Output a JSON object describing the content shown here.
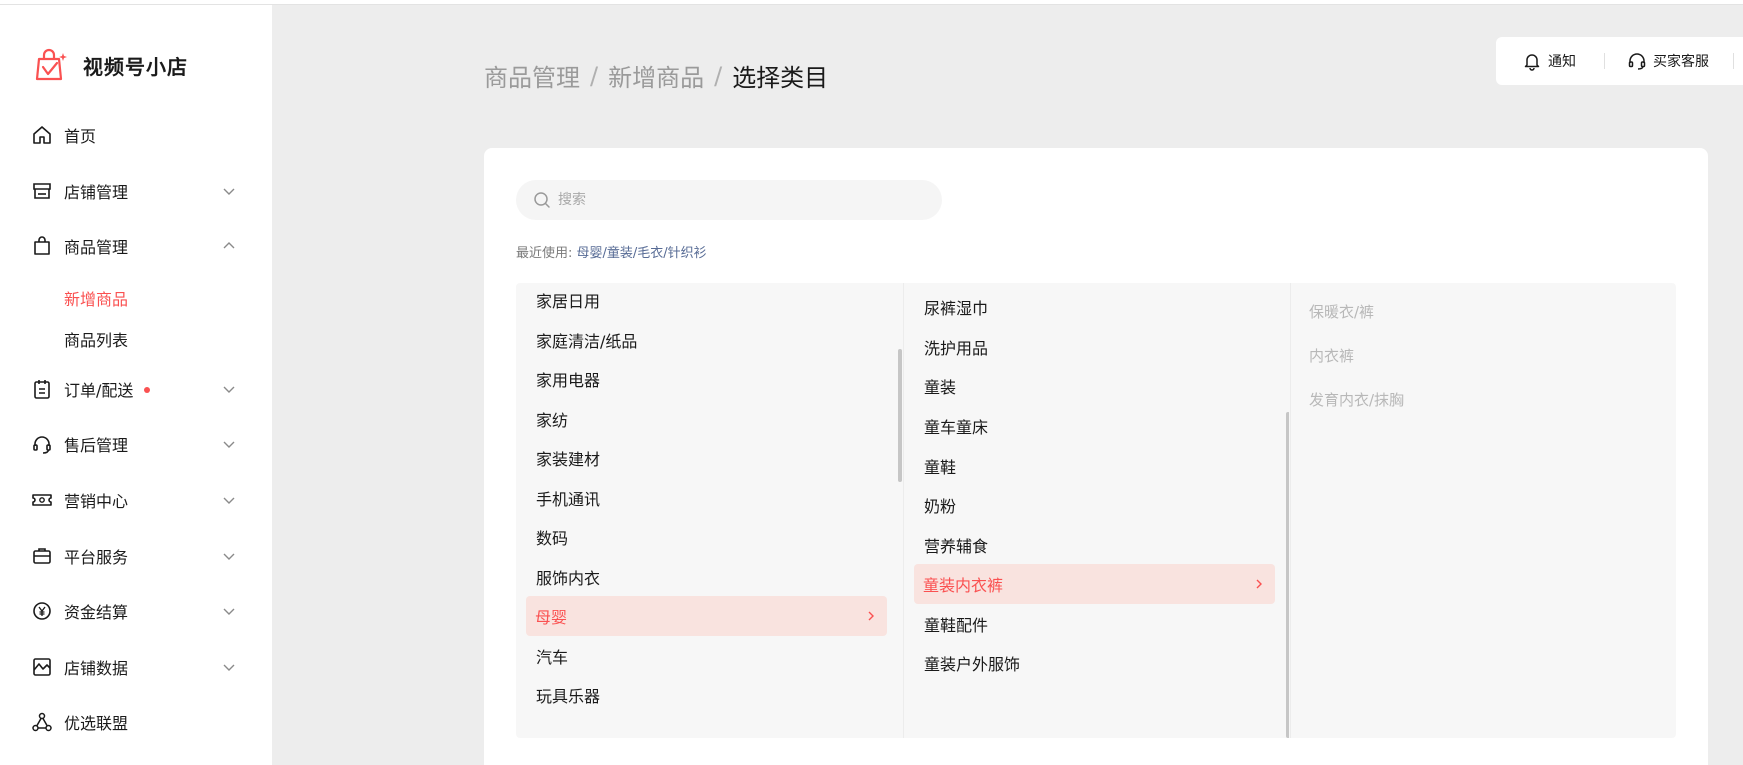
{
  "app": {
    "name": "视频号小店"
  },
  "sidebar": {
    "items": [
      {
        "label": "首页",
        "icon": "home-icon"
      },
      {
        "label": "店铺管理",
        "icon": "store-icon"
      },
      {
        "label": "商品管理",
        "icon": "shopping-bag-icon"
      },
      {
        "label": "订单/配送",
        "icon": "clipboard-icon"
      },
      {
        "label": "售后管理",
        "icon": "headset-icon"
      },
      {
        "label": "营销中心",
        "icon": "ticket-icon"
      },
      {
        "label": "平台服务",
        "icon": "briefcase-icon"
      },
      {
        "label": "资金结算",
        "icon": "yuan-coin-icon"
      },
      {
        "label": "店铺数据",
        "icon": "chart-icon"
      },
      {
        "label": "优选联盟",
        "icon": "network-icon"
      }
    ],
    "sub_items": [
      {
        "label": "新增商品",
        "active": true
      },
      {
        "label": "商品列表",
        "active": false
      }
    ]
  },
  "toolbar": {
    "notify": "通知",
    "service": "买家客服"
  },
  "breadcrumb": {
    "level1": "商品管理",
    "level2": "新增商品",
    "current": "选择类目",
    "separator": "/"
  },
  "search": {
    "placeholder": "搜索",
    "value": ""
  },
  "recent": {
    "label": "最近使用:",
    "path": "母婴/童装/毛衣/针织衫"
  },
  "columns": {
    "level1": [
      "家居日用",
      "家庭清洁/纸品",
      "家用电器",
      "家纺",
      "家装建材",
      "手机通讯",
      "数码",
      "服饰内衣",
      "母婴",
      "汽车",
      "玩具乐器"
    ],
    "level1_selected": "母婴",
    "level2": [
      "尿裤湿巾",
      "洗护用品",
      "童装",
      "童车童床",
      "童鞋",
      "奶粉",
      "营养辅食",
      "童装内衣裤",
      "童鞋配件",
      "童装户外服饰"
    ],
    "level2_selected": "童装内衣裤",
    "level3": [
      "保暖衣/裤",
      "内衣裤",
      "发育内衣/抹胸"
    ]
  },
  "colors": {
    "accent": "#fa5151",
    "link": "#576b95",
    "selected_bg": "#f9e3df"
  }
}
